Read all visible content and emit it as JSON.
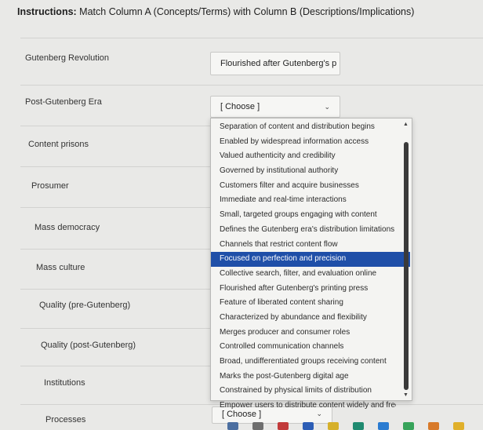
{
  "instructions": {
    "lead": "Instructions:",
    "text": " Match Column A (Concepts/Terms) with Column B (Descriptions/Implications)"
  },
  "rows": [
    {
      "term": "Gutenberg Revolution",
      "answer": "Flourished after Gutenberg's p"
    },
    {
      "term": "Post-Gutenberg Era",
      "answer": "[ Choose ]"
    },
    {
      "term": "Content prisons"
    },
    {
      "term": "Prosumer"
    },
    {
      "term": "Mass democracy"
    },
    {
      "term": "Mass culture"
    },
    {
      "term": "Quality (pre-Gutenberg)"
    },
    {
      "term": "Quality (post-Gutenberg)"
    },
    {
      "term": "Institutions"
    },
    {
      "term": "Processes",
      "answer": "[ Choose ]"
    }
  ],
  "dropdown": {
    "options": [
      "Separation of content and distribution begins",
      "Enabled by widespread information access",
      "Valued authenticity and credibility",
      "Governed by institutional authority",
      "Customers filter and acquire businesses",
      "Immediate and real-time interactions",
      "Small, targeted groups engaging with content",
      "Defines the Gutenberg era's distribution limitations",
      "Channels that restrict content flow",
      "Focused on perfection and precision",
      "Collective search, filter, and evaluation online",
      "Flourished after Gutenberg's printing press",
      "Feature of liberated content sharing",
      "Characterized by abundance and flexibility",
      "Merges producer and consumer roles",
      "Controlled communication channels",
      "Broad, undifferentiated groups receiving content",
      "Marks the post-Gutenberg digital age",
      "Constrained by physical limits of distribution",
      "Empower users to distribute content widely and freely"
    ],
    "selected_index": 9
  },
  "colors": {
    "selected_bg": "#1f4fa8",
    "page_bg": "#e9e9e7"
  }
}
